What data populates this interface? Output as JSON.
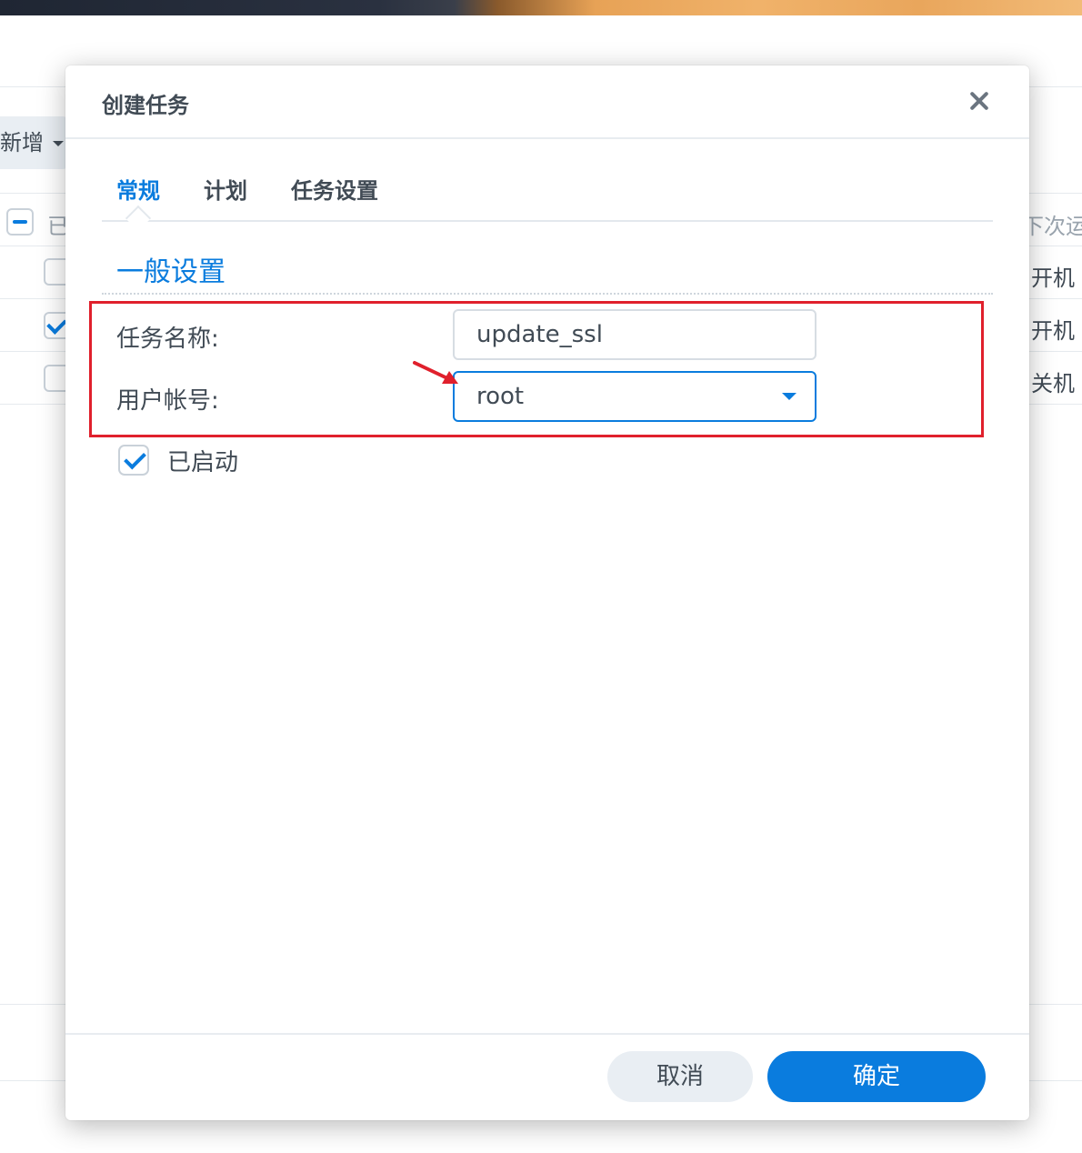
{
  "background": {
    "new_button_label": "新增",
    "header_col1": "已",
    "header_col_right": "下次运",
    "row_texts": [
      "开机",
      "开机",
      "关机"
    ]
  },
  "dialog": {
    "title": "创建任务",
    "tabs": [
      {
        "label": "常规",
        "active": true
      },
      {
        "label": "计划",
        "active": false
      },
      {
        "label": "任务设置",
        "active": false
      }
    ],
    "section_title": "一般设置",
    "fields": {
      "task_name_label": "任务名称:",
      "task_name_value": "update_ssl",
      "user_label": "用户帐号:",
      "user_value": "root"
    },
    "enabled_checkbox": {
      "label": "已启动",
      "checked": true
    },
    "buttons": {
      "cancel": "取消",
      "ok": "确定"
    }
  },
  "colors": {
    "accent": "#0a7cde",
    "annotation_red": "#e0202c",
    "text": "#414b55"
  }
}
